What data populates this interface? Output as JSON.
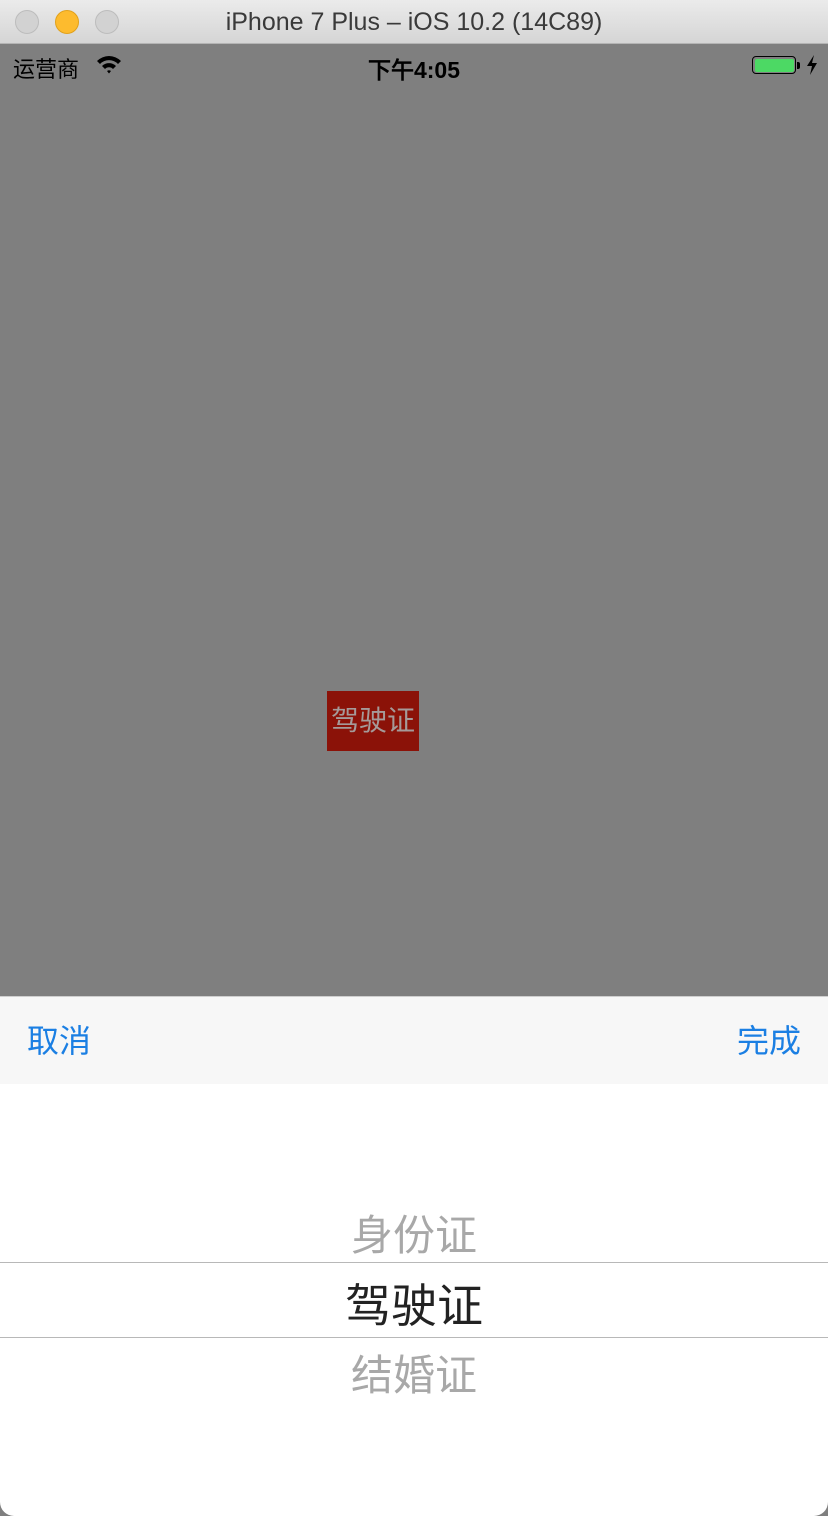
{
  "window": {
    "title": "iPhone 7 Plus – iOS 10.2 (14C89)"
  },
  "status_bar": {
    "carrier": "运营商",
    "time": "下午4:05",
    "battery_color": "#4cd964"
  },
  "main": {
    "selected_label": "驾驶证",
    "label_background": "#8b1208"
  },
  "toolbar": {
    "cancel_label": "取消",
    "done_label": "完成",
    "accent_color": "#1b7fe3"
  },
  "picker": {
    "options": [
      "身份证",
      "驾驶证",
      "结婚证"
    ],
    "selected": "驾驶证"
  }
}
